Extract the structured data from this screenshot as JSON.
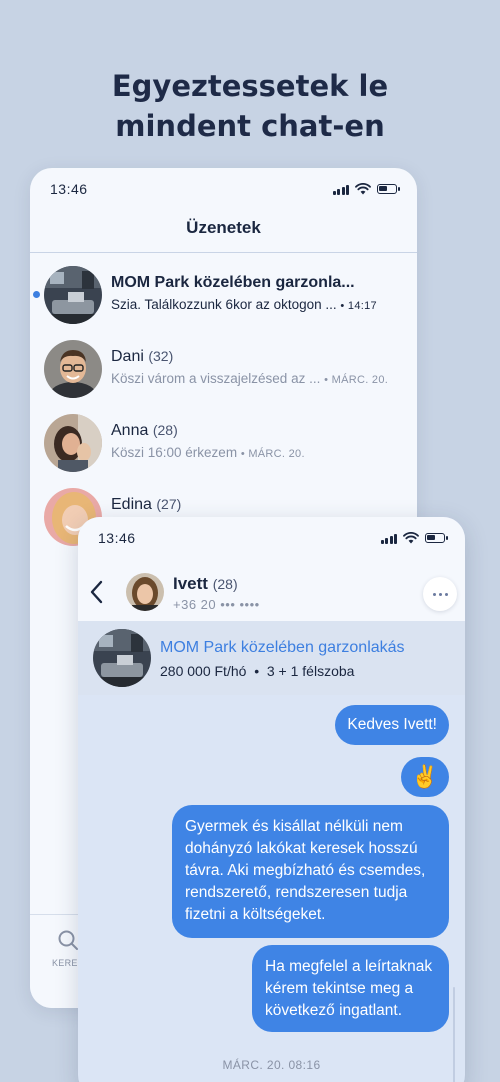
{
  "headline": {
    "line1": "Egyeztessetek le",
    "line2": "mindent chat-en"
  },
  "back_phone": {
    "status_time": "13:46",
    "title": "Üzenetek",
    "conversations": [
      {
        "name": "MOM Park közelében garzonla...",
        "age": "",
        "preview": "Szia. Találkozzunk 6kor az oktogon ...",
        "time": "• 14:17",
        "unread": true
      },
      {
        "name": "Dani",
        "age": "(32)",
        "preview": "Köszi várom a visszajelzésed az ...",
        "time": "• MÁRC. 20.",
        "unread": false
      },
      {
        "name": "Anna",
        "age": "(28)",
        "preview": "Köszi 16:00 érkezem",
        "time": "• MÁRC. 20.",
        "unread": false
      },
      {
        "name": "Edina",
        "age": "(27)",
        "preview": "",
        "time": "",
        "unread": false
      }
    ],
    "tab_search_label": "KERES"
  },
  "front_phone": {
    "status_time": "13:46",
    "contact": {
      "name": "Ivett",
      "age": "(28)",
      "phone": "+36 20 ••• ••••"
    },
    "listing": {
      "title": "MOM Park közelében garzonlakás",
      "price": "280 000 Ft/hó",
      "rooms": "3 + 1 félszoba",
      "separator": "•"
    },
    "messages": [
      "Kedves Ivett!",
      "✌",
      "Gyermek és kisállat nélküli nem dohányzó lakókat keresek hosszú távra. Aki megbízható és csemdes, rendszerető, rendszeresen tudja fizetni a költségeket.",
      "Ha megfelel a leírtaknak kérem tekintse meg a következő ingatlant."
    ],
    "date": "MÁRC. 20. 08:16"
  },
  "colors": {
    "accent": "#3f84e5",
    "background": "#c7d3e4",
    "text_dark": "#1b2740",
    "text_muted": "#8a93a6"
  }
}
